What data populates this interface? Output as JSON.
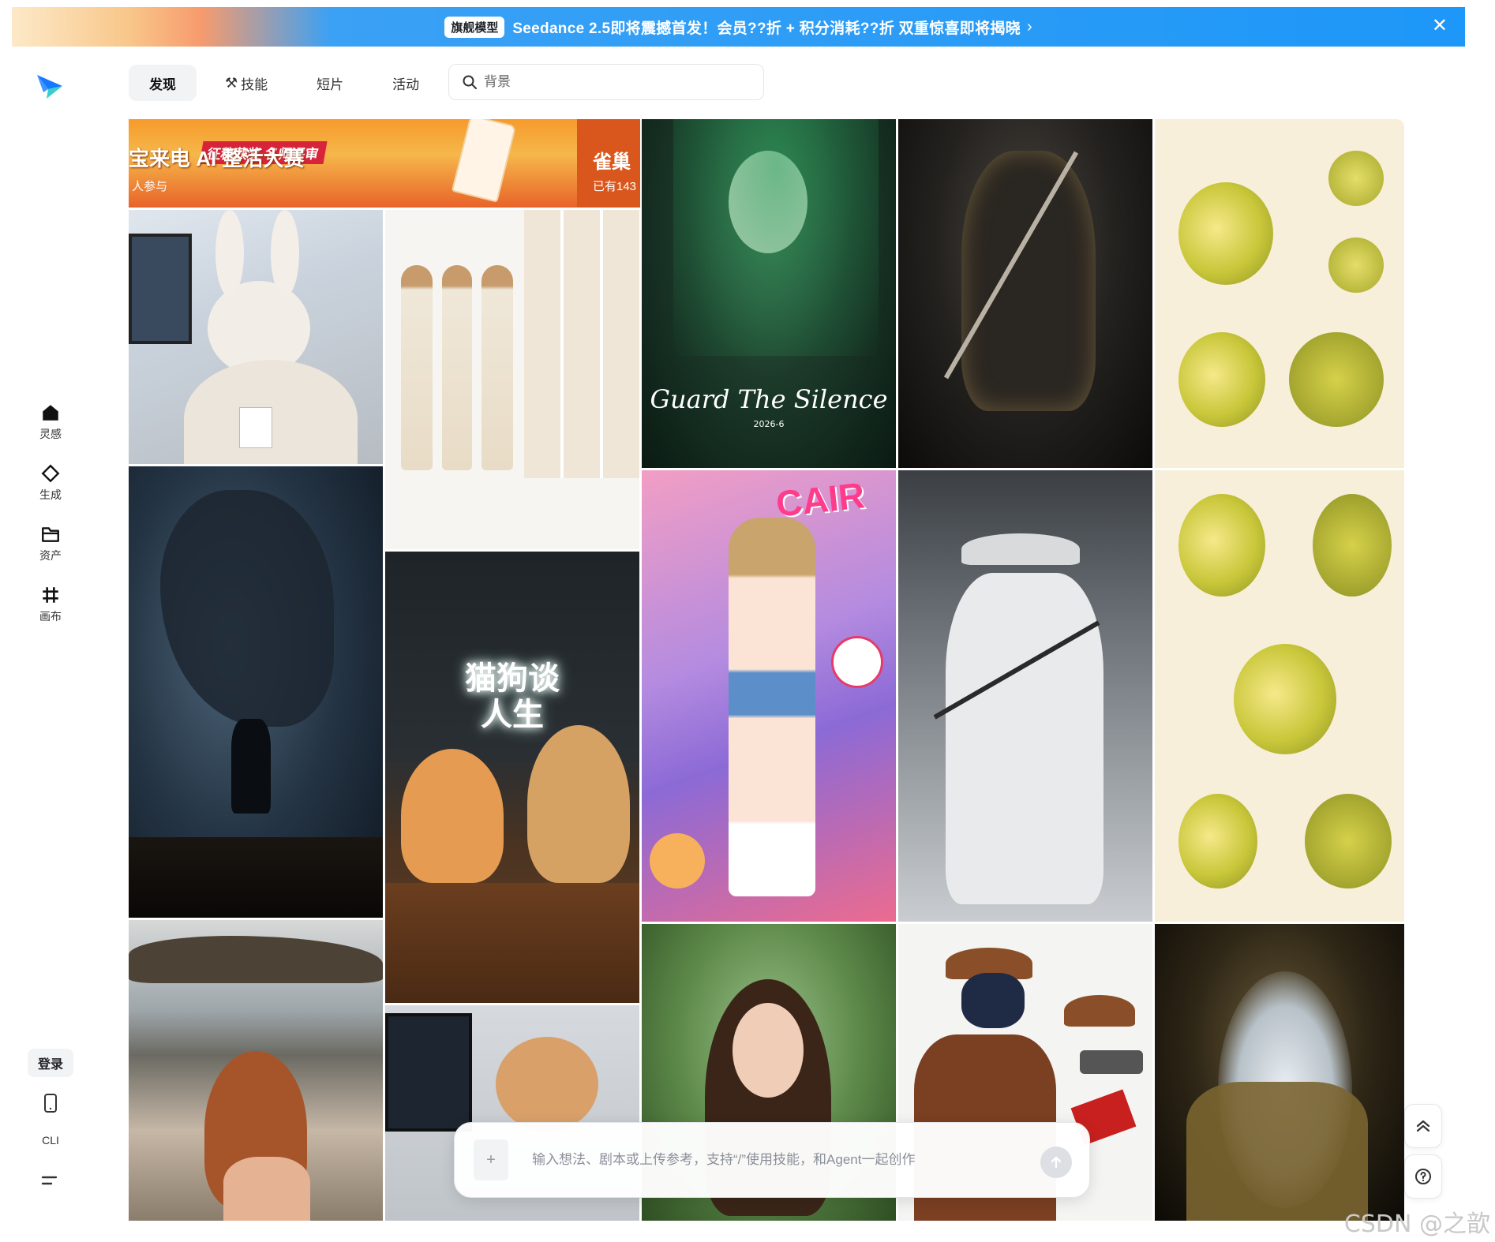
{
  "banner": {
    "badge": "旗舰模型",
    "text": "Seedance 2.5即将震撼首发！会员??折 + 积分消耗??折 双重惊喜即将揭晓",
    "chevron_icon": "chevron-right-icon",
    "close_icon": "close-icon"
  },
  "sidebar": {
    "logo_icon": "paper-plane-logo-icon",
    "items": [
      {
        "label": "灵感",
        "icon": "home-icon"
      },
      {
        "label": "生成",
        "icon": "diamond-icon"
      },
      {
        "label": "资产",
        "icon": "folder-icon"
      },
      {
        "label": "画布",
        "icon": "hash-icon"
      }
    ],
    "login": "登录",
    "mobile_icon": "mobile-icon",
    "cli": "CLI",
    "menu_icon": "menu-icon"
  },
  "tabs": [
    {
      "label": "发现",
      "active": true
    },
    {
      "label": "技能",
      "icon": "tools-icon"
    },
    {
      "label": "短片"
    },
    {
      "label": "活动"
    }
  ],
  "search": {
    "placeholder": "背景",
    "icon": "search-icon"
  },
  "gallery": {
    "banner_tile": {
      "text_main": "宝来电 AI 整活大赛",
      "text_tag": "征稿获奖 名师评审",
      "text_sub": "人参与",
      "text_right": "雀巢",
      "text_right_sub": "已有143"
    },
    "tile_guard": {
      "title": "Guard The Silence",
      "sub": "2026-6"
    },
    "tile_podcast": {
      "title_line1": "猫狗谈",
      "title_line2": "人生"
    },
    "tile_magazine": {
      "title": "CAIR"
    }
  },
  "prompt": {
    "placeholder": "输入想法、剧本或上传参考，支持“/”使用技能，和Agent一起创作",
    "plus_icon": "plus-icon",
    "send_icon": "arrow-up-icon"
  },
  "fabs": {
    "top_icon": "double-chevron-up-icon",
    "help_icon": "help-circle-icon"
  },
  "watermark": "CSDN @之歆"
}
